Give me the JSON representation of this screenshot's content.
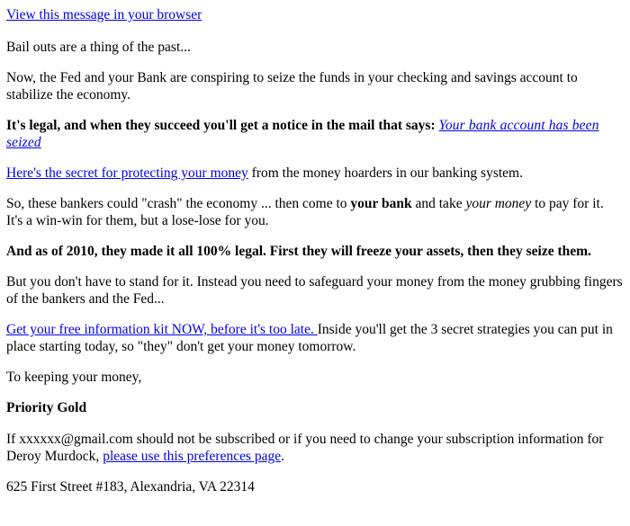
{
  "document": {
    "type": "html-email",
    "background_color": "#ffffff",
    "text_color": "#000000",
    "link_color": "#0000ee"
  },
  "header": {
    "view_in_browser_label": "View this message in your browser"
  },
  "content": {
    "p1": "Bail outs are a thing of the past...",
    "p2": "Now, the Fed and your Bank are conspiring to seize the funds in your checking and savings account to stabilize the economy.",
    "p3": {
      "bold_lead": "It's legal, and when they succeed you'll get a notice in the mail that says:",
      "link_text": "Your bank account has been seized"
    },
    "p4": {
      "link_text": "Here's the secret for protecting your money",
      "rest": " from the money hoarders in our banking system."
    },
    "p5": {
      "part1": "So, these bankers could \"crash\" the economy ... then come to ",
      "bold1": "your bank",
      "part2": " and take ",
      "italic1": "your money",
      "part3": " to pay for it.  It's a win-win for them, but a lose-lose for you."
    },
    "p6_bold": "And as of 2010, they made it all 100% legal.  First they will freeze your assets, then they seize them.",
    "p7": "But you don't have to stand for it.  Instead you need to safeguard your money from the money grubbing fingers of the bankers and the Fed...",
    "p8": {
      "link_text": "Get your free information kit NOW, before it's too late. ",
      "rest": " Inside you'll get the 3 secret strategies you can put in place starting today, so \"they\" don't get your money tomorrow."
    },
    "p9_closing": "To keeping your money,",
    "signature": "Priority Gold"
  },
  "footer": {
    "unsubscribe_part1": "If xxxxxx@gmail.com should not be subscribed or if you need to change your subscription information for Deroy Murdock, ",
    "preferences_link_text": "please use this preferences page",
    "unsubscribe_part2": ".",
    "address": "625 First Street #183, Alexandria, VA 22314"
  }
}
